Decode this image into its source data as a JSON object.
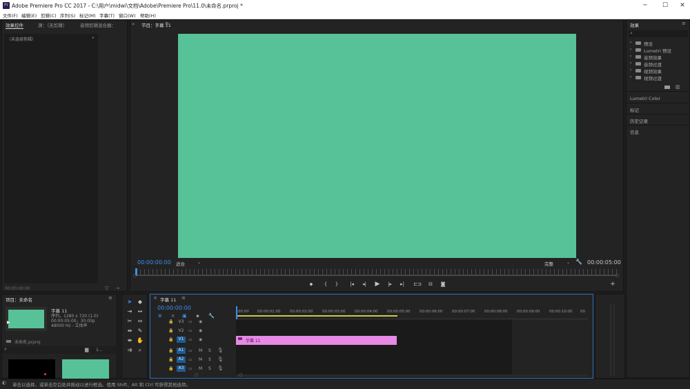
{
  "window": {
    "title": "Adobe Premiere Pro CC 2017 - C:\\用户\\midwi\\文档\\Adobe\\Premiere Pro\\11.0\\未命名.prproj *",
    "app_icon": "Pr"
  },
  "menu": [
    "文件(F)",
    "编辑(E)",
    "剪辑(C)",
    "序列(S)",
    "标记(M)",
    "字幕(T)",
    "窗口(W)",
    "帮助(H)"
  ],
  "source_panel": {
    "tabs": [
      "效果控件",
      "源：（无剪辑）",
      "音频剪辑混合器："
    ],
    "no_clip": "（未选择剪辑）",
    "timecode": "00:00:00:00"
  },
  "program_monitor": {
    "tab": "节目：字幕 11",
    "frame_color": "#57c197",
    "timecode_left": "00:00:00:00",
    "fit": "适合",
    "quality": "完整",
    "timecode_right": "00:00:05:00"
  },
  "effects_panel": {
    "title": "效果",
    "items": [
      "预设",
      "Lumetri 预设",
      "音频效果",
      "音频过渡",
      "视频效果",
      "视频过渡"
    ],
    "sections": [
      "Lumetri Color",
      "标记",
      "历史记录",
      "信息"
    ]
  },
  "project_panel": {
    "title": "项目：未命名",
    "item_name": "字幕 11",
    "item_info": [
      "序列，1280 x 720 (1.0)",
      "00:00:05:00，30.00p",
      "48000 Hz - 立体声"
    ],
    "project_file": "未命名.prproj",
    "count": "1..."
  },
  "timeline": {
    "tab": "字幕 11",
    "timecode": "00:00:00:00",
    "ruler": [
      ":00:00",
      "00:00:01:00",
      "00:00:02:00",
      "00:00:03:00",
      "00:00:04:00",
      "00:00:05:00",
      "00:00:06:00",
      "00:00:07:00",
      "00:00:08:00",
      "00:00:09:00",
      "00:00:10:00",
      "00"
    ],
    "video_tracks": [
      "V3",
      "V2",
      "V1"
    ],
    "audio_tracks": [
      "A1",
      "A2",
      "A3"
    ],
    "track_m": "M",
    "track_s": "S",
    "clip_label": "字幕 11",
    "clip_color": "#e68ae6"
  },
  "status_bar": "单击以选择，或单击空白处并拖动以进行框选。使用 Shift、Alt 和 Ctrl 可获得其他选项。"
}
